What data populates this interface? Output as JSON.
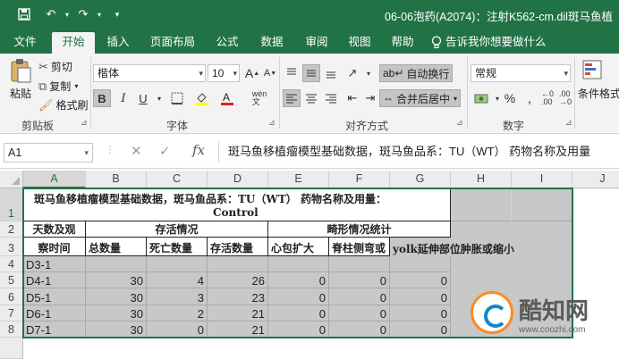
{
  "titlebar": {
    "title": "06-06泡药(A2074)：注射K562-cm.dil斑马鱼植",
    "undo_icon": "undo-icon",
    "redo_icon": "redo-icon",
    "save_icon": "save-icon"
  },
  "tabs": [
    {
      "label": "文件"
    },
    {
      "label": "开始"
    },
    {
      "label": "插入"
    },
    {
      "label": "页面布局"
    },
    {
      "label": "公式"
    },
    {
      "label": "数据"
    },
    {
      "label": "审阅"
    },
    {
      "label": "视图"
    },
    {
      "label": "帮助"
    }
  ],
  "tell_me": "告诉我你想要做什么",
  "clipboard": {
    "paste": "粘贴",
    "cut": "剪切",
    "copy": "复制",
    "format_painter": "格式刷",
    "group": "剪贴板"
  },
  "font": {
    "name": "楷体",
    "size": "10",
    "group": "字体"
  },
  "alignment": {
    "wrap": "自动换行",
    "merge": "合并后居中",
    "group": "对齐方式"
  },
  "number": {
    "format": "常规",
    "group": "数字"
  },
  "styles": {
    "conditional": "条件格式"
  },
  "formula_bar": {
    "name_box": "A1",
    "content": "斑马鱼移植瘤模型基础数据，斑马鱼品系：TU（WT）  药物名称及用量"
  },
  "columns": [
    "A",
    "B",
    "C",
    "D",
    "E",
    "F",
    "G",
    "H",
    "I",
    "J"
  ],
  "rows": [
    "1",
    "2",
    "3",
    "4",
    "5",
    "6",
    "7",
    "8"
  ],
  "sheet": {
    "a1_line1": "斑马鱼移植瘤模型基础数据，斑马鱼品系：TU（WT）   药物名称及用量：",
    "a1_line2": "Control",
    "a2": "天数及观",
    "a3": "察时间",
    "b2": "存活情况",
    "e2": "畸形情况统计",
    "headers": [
      "总数量",
      "死亡数量",
      "存活数量",
      "心包扩大",
      "脊柱侧弯或",
      "yolk延伸部位肿胀或缩小"
    ],
    "data_rows": [
      {
        "label": "D3-1",
        "values": [
          "",
          "",
          "",
          "",
          "",
          ""
        ]
      },
      {
        "label": "D4-1",
        "values": [
          "30",
          "4",
          "26",
          "0",
          "0",
          "0"
        ]
      },
      {
        "label": "D5-1",
        "values": [
          "30",
          "3",
          "23",
          "0",
          "0",
          "0"
        ]
      },
      {
        "label": "D6-1",
        "values": [
          "30",
          "2",
          "21",
          "0",
          "0",
          "0"
        ]
      },
      {
        "label": "D7-1",
        "values": [
          "30",
          "0",
          "21",
          "0",
          "0",
          "0"
        ]
      }
    ]
  },
  "watermark": {
    "brand": "酷知网",
    "url": "www.coozhi.com"
  },
  "colors": {
    "excel_green": "#217346",
    "cell_shade": "#c8c8c8"
  }
}
